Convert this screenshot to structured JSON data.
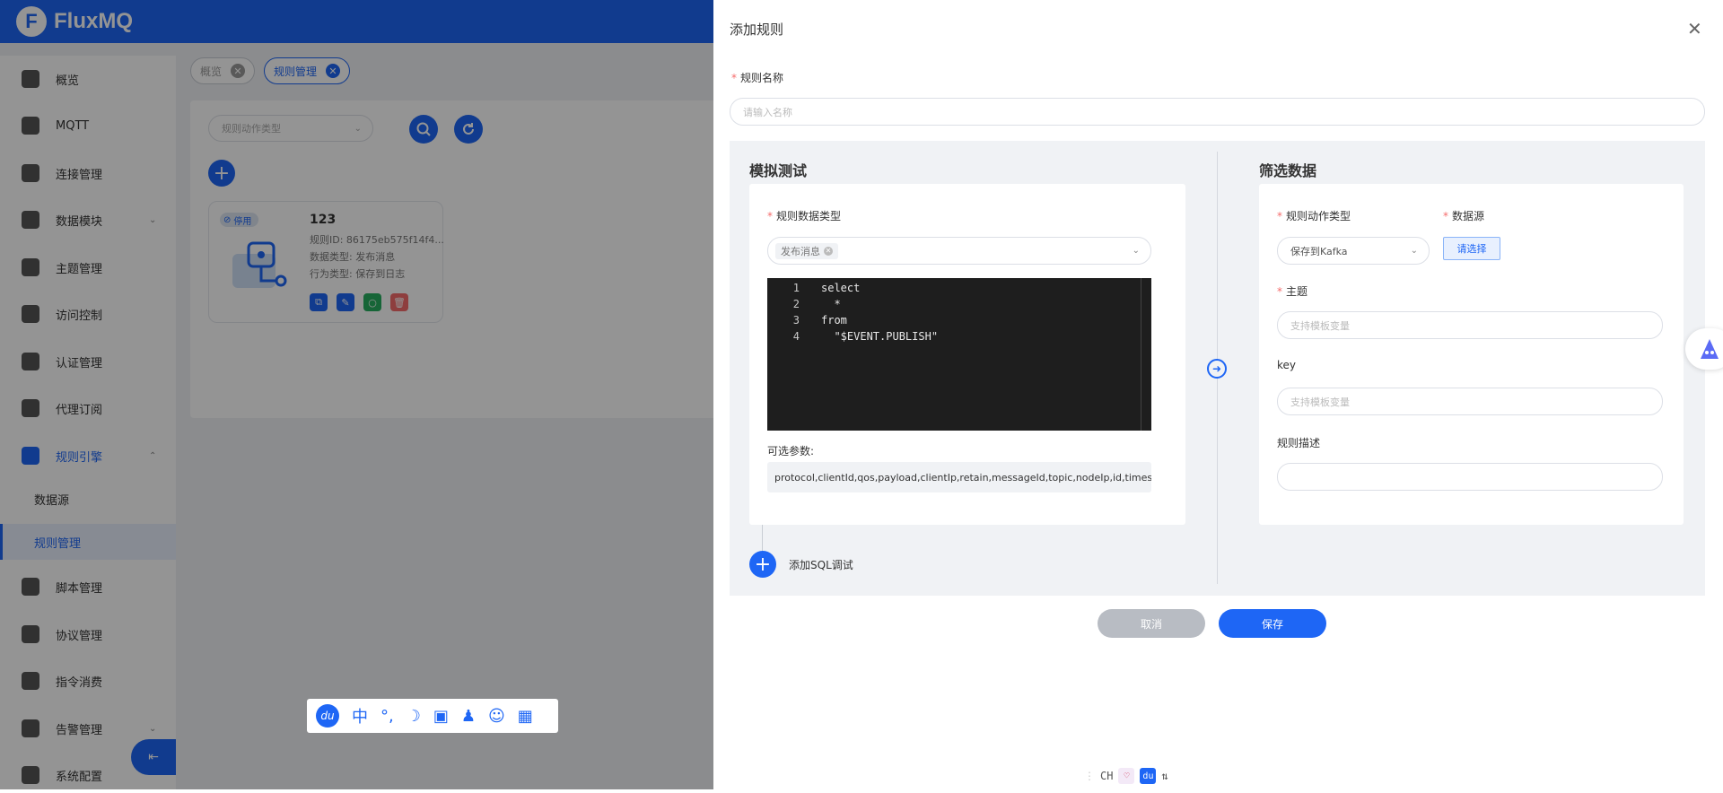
{
  "app": {
    "brand": "FluxMQ",
    "brand_mark": "F"
  },
  "sidebar": {
    "items": [
      {
        "label": "概览"
      },
      {
        "label": "MQTT"
      },
      {
        "label": "连接管理"
      },
      {
        "label": "数据模块"
      },
      {
        "label": "主题管理"
      },
      {
        "label": "访问控制"
      },
      {
        "label": "认证管理"
      },
      {
        "label": "代理订阅"
      },
      {
        "label": "规则引擎"
      },
      {
        "label": "数据源"
      },
      {
        "label": "规则管理"
      },
      {
        "label": "脚本管理"
      },
      {
        "label": "协议管理"
      },
      {
        "label": "指令消费"
      },
      {
        "label": "告警管理"
      },
      {
        "label": "系统配置"
      }
    ]
  },
  "tabs": [
    {
      "label": "概览"
    },
    {
      "label": "规则管理"
    }
  ],
  "list": {
    "filter_placeholder": "规则动作类型",
    "card": {
      "status": "停用",
      "title": "123",
      "rule_id": "规则ID: 86175eb575f14f4...",
      "data_type": "数据类型: 发布消息",
      "action_type": "行为类型: 保存到日志"
    }
  },
  "drawer": {
    "title": "添加规则",
    "rule_name_label": "规则名称",
    "rule_name_placeholder": "请输入名称",
    "sim": {
      "title": "模拟测试",
      "data_type_label": "规则数据类型",
      "data_type_tag": "发布消息",
      "code_lines": [
        {
          "n": "1",
          "text": "select"
        },
        {
          "n": "2",
          "text": "  *"
        },
        {
          "n": "3",
          "text": "from"
        },
        {
          "n": "4",
          "text": "  \"$EVENT.PUBLISH\""
        }
      ],
      "params_label": "可选参数:",
      "params_value": "protocol,clientId,qos,payload,clientIp,retain,messageId,topic,nodeIp,id,timestamp",
      "add_sql_label": "添加SQL调试"
    },
    "filter": {
      "title": "筛选数据",
      "action_type_label": "规则动作类型",
      "action_type_value": "保存到Kafka",
      "datasource_label": "数据源",
      "datasource_button": "请选择",
      "topic_label": "主题",
      "topic_placeholder": "支持模板变量",
      "key_label": "key",
      "key_placeholder": "支持模板变量",
      "desc_label": "规则描述"
    },
    "cancel_label": "取消",
    "save_label": "保存"
  },
  "ime": {
    "logo": "du",
    "chinese": "中",
    "status_text": "CH",
    "status_du": "du"
  },
  "colors": {
    "primary": "#1e66f5",
    "danger": "#f56c6c",
    "cancel": "#b8bcc3",
    "editor_bg": "#1e1e1e"
  }
}
